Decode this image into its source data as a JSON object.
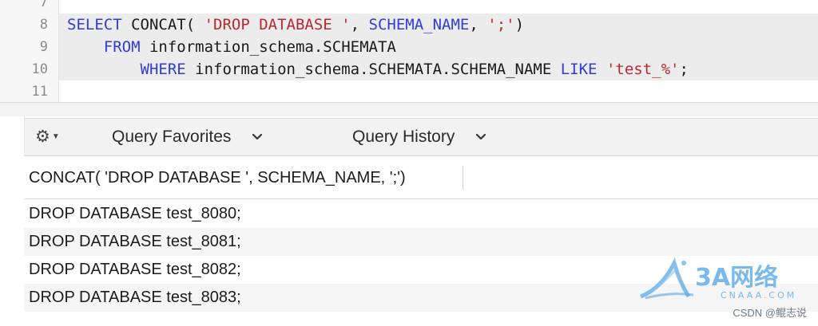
{
  "editor": {
    "lines": [
      {
        "num": "7",
        "tokens": []
      },
      {
        "num": "8",
        "tokens": [
          {
            "t": "SELECT",
            "c": "kw"
          },
          {
            "t": " CONCAT( ",
            "c": ""
          },
          {
            "t": "'DROP DATABASE '",
            "c": "str"
          },
          {
            "t": ", ",
            "c": ""
          },
          {
            "t": "SCHEMA_NAME",
            "c": "kw"
          },
          {
            "t": ", ",
            "c": ""
          },
          {
            "t": "';'",
            "c": "str"
          },
          {
            "t": ")",
            "c": ""
          }
        ]
      },
      {
        "num": "9",
        "tokens": [
          {
            "t": "    ",
            "c": ""
          },
          {
            "t": "FROM",
            "c": "kw"
          },
          {
            "t": " information_schema.SCHEMATA",
            "c": ""
          }
        ]
      },
      {
        "num": "10",
        "tokens": [
          {
            "t": "        ",
            "c": ""
          },
          {
            "t": "WHERE",
            "c": "kw"
          },
          {
            "t": " information_schema.SCHEMATA.SCHEMA_NAME ",
            "c": ""
          },
          {
            "t": "LIKE",
            "c": "kw"
          },
          {
            "t": " ",
            "c": ""
          },
          {
            "t": "'test_%'",
            "c": "str"
          },
          {
            "t": ";",
            "c": ""
          }
        ]
      },
      {
        "num": "11",
        "tokens": []
      }
    ]
  },
  "toolbar": {
    "gear_icon": "gear-icon",
    "query_favorites": "Query Favorites",
    "query_history": "Query History"
  },
  "results": {
    "column_header": "CONCAT( 'DROP DATABASE ', SCHEMA_NAME, ';')",
    "rows": [
      "DROP DATABASE test_8080;",
      "DROP DATABASE test_8081;",
      "DROP DATABASE test_8082;",
      "DROP DATABASE test_8083;"
    ]
  },
  "watermark": {
    "logo_text": "3A网络",
    "logo_sub": "CNAAA.COM",
    "credit": "CSDN @鲲志说"
  },
  "colors": {
    "keyword": "#2f3cd6",
    "string": "#b8292f",
    "watermark": "#2f8fd6"
  }
}
